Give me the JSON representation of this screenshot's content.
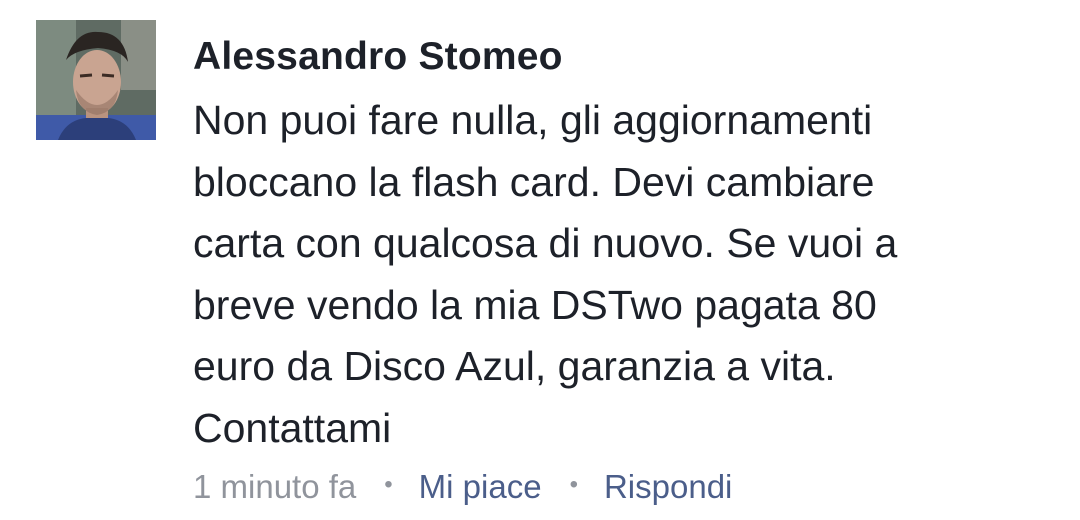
{
  "comment": {
    "author": "Alessandro Stomeo",
    "avatar_icon": "profile-photo",
    "lines": [
      "Non puoi fare nulla, gli aggiornamenti",
      "bloccano la flash card. Devi cambiare",
      "carta con qualcosa di nuovo. Se vuoi a",
      "breve vendo la mia DSTwo pagata 80",
      "euro da Disco Azul, garanzia a vita.",
      "Contattami"
    ],
    "timestamp": "1 minuto fa",
    "separator": "•",
    "like_label": "Mi piace",
    "reply_label": "Rispondi"
  },
  "colors": {
    "text": "#1d2129",
    "meta_gray": "#90949c",
    "action_blue": "#4b5e8a"
  }
}
